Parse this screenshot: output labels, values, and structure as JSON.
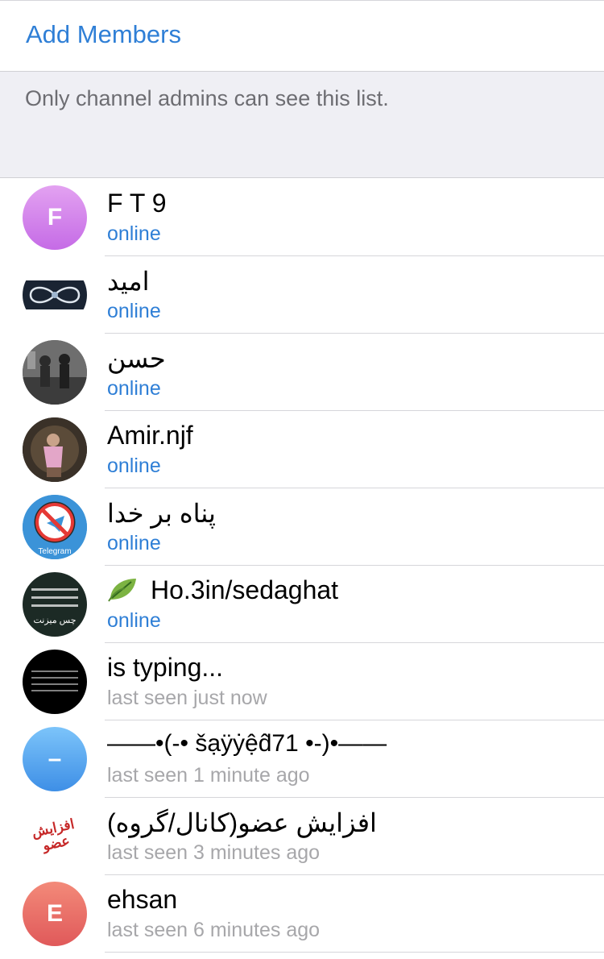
{
  "header": {
    "add_members": "Add Members"
  },
  "notice": {
    "text": "Only channel admins can see this list."
  },
  "members": [
    {
      "name": "F T 9",
      "status": "online",
      "initial": "F"
    },
    {
      "name": "امید",
      "status": "online"
    },
    {
      "name": "حسن",
      "status": "online"
    },
    {
      "name": "Amir.njf",
      "status": "online"
    },
    {
      "name": "پناه بر خدا",
      "status": "online",
      "avatar_text": "Telegram"
    },
    {
      "name": "Ho.3in/sedaghat",
      "status": "online",
      "avatar_text": "چس میزنت"
    },
    {
      "name": "is typing...",
      "status": "last seen just now"
    },
    {
      "name": "——•(-• šạÿẏệd̂71 •-)•——",
      "status": "last seen 1 minute ago",
      "initial": "–"
    },
    {
      "name": "افزایش عضو(کانال/گروه)",
      "status": "last seen 3 minutes ago",
      "avatar_text": "افزایش عضو"
    },
    {
      "name": "ehsan",
      "status": "last seen 6 minutes ago",
      "initial": "E"
    }
  ],
  "colors": {
    "accent": "#2f7fd6",
    "seen": "#a7a7aa",
    "background_notice": "#efeff4"
  }
}
